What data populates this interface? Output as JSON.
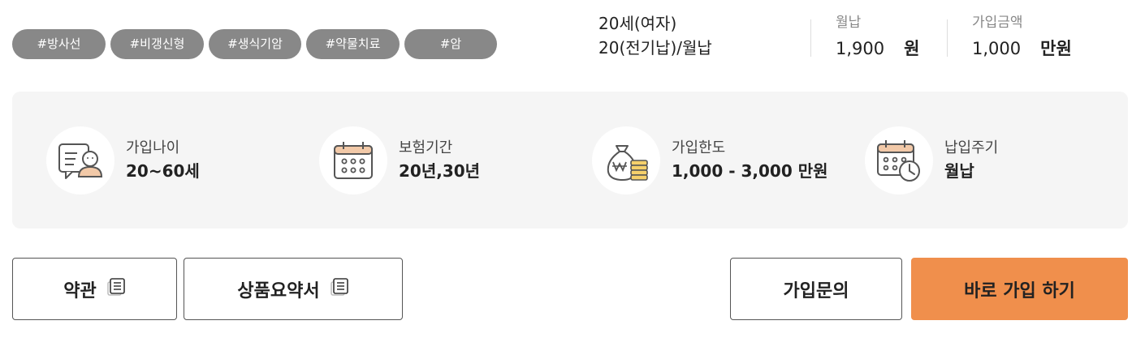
{
  "tags": [
    "#방사선",
    "#비갱신형",
    "#생식기암",
    "#약물치료",
    "#암"
  ],
  "condition": {
    "age_gender": "20세(여자)",
    "term": "20(전기납)/월납"
  },
  "premium": {
    "label": "월납",
    "value": "1,900",
    "unit": "원"
  },
  "coverage": {
    "label": "가입금액",
    "value": "1,000",
    "unit": "만원"
  },
  "info_items": [
    {
      "icon": "person-chat-icon",
      "label": "가입나이",
      "value": "20~60세"
    },
    {
      "icon": "calendar-icon",
      "label": "보험기간",
      "value": "20년,30년"
    },
    {
      "icon": "money-bag-icon",
      "label": "가입한도",
      "value": "1,000 - 3,000 만원"
    },
    {
      "icon": "calendar-clock-icon",
      "label": "납입주기",
      "value": "월납"
    }
  ],
  "buttons": {
    "terms": "약관",
    "summary": "상품요약서",
    "inquiry": "가입문의",
    "join_now": "바로 가입 하기"
  },
  "colors": {
    "tag_bg": "#888888",
    "panel_bg": "#f5f5f5",
    "primary": "#f08f4c"
  }
}
